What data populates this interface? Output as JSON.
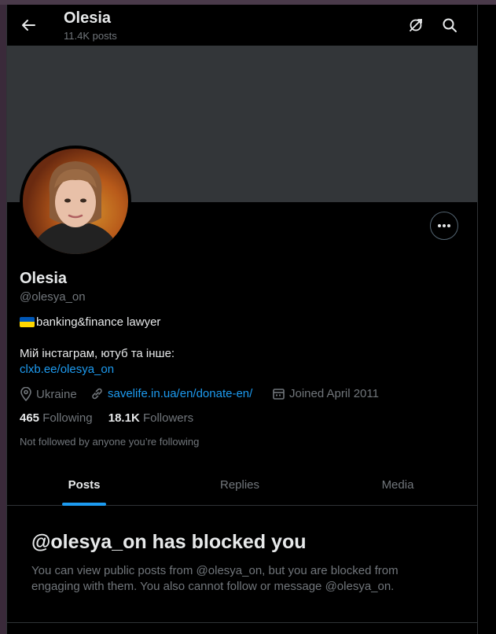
{
  "header": {
    "title": "Olesia",
    "posts_count": "11.4K posts"
  },
  "profile": {
    "name": "Olesia",
    "handle": "@olesya_on",
    "bio_line1": "banking&finance lawyer",
    "bio_line2": "Мій інстаграм, ютуб та інше:",
    "bio_link": "clxb.ee/olesya_on",
    "location": "Ukraine",
    "website": "savelife.in.ua/en/donate-en/",
    "joined": "Joined April 2011",
    "following_count": "465",
    "following_label": "Following",
    "followers_count": "18.1K",
    "followers_label": "Followers",
    "not_followed_text": "Not followed by anyone you’re following"
  },
  "tabs": [
    {
      "label": "Posts",
      "active": true
    },
    {
      "label": "Replies",
      "active": false
    },
    {
      "label": "Media",
      "active": false
    }
  ],
  "blocked": {
    "title": "@olesya_on has blocked you",
    "message": "You can view public posts from @olesya_on, but you are blocked from engaging with them. You also cannot follow or message @olesya_on."
  },
  "colors": {
    "accent": "#1d9bf0",
    "background": "#000000",
    "muted": "#71767b",
    "banner": "#333639"
  },
  "icons": [
    "back-arrow-icon",
    "no-refresh-icon",
    "search-icon",
    "more-icon",
    "location-icon",
    "link-icon",
    "calendar-icon",
    "ukraine-flag-icon"
  ]
}
